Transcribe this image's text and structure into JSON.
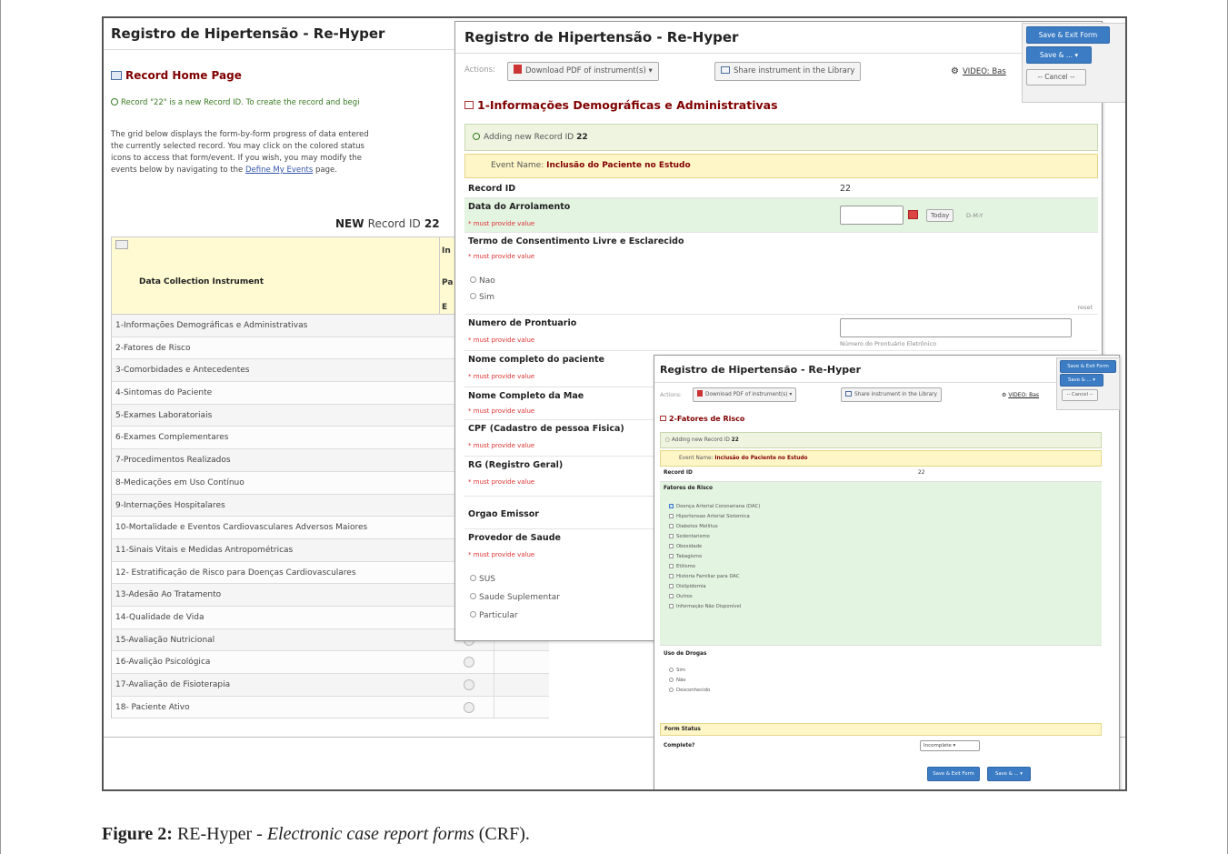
{
  "window1": {
    "title": "Registro de Hipertensão - Re-Hyper",
    "section_title": "Record Home Page",
    "new_record_msg": "Record \"22\" is a new Record ID. To create the record and begi",
    "description_a": "The grid below displays the form-by-form progress of data entered",
    "description_b": "the currently selected record. You may click on the colored status",
    "description_c": "icons to access that form/event. If you wish, you may modify the",
    "description_d_pre": "events below by navigating to the",
    "description_link": "Define My Events",
    "description_d_post": "page.",
    "grid_title_bold": "NEW",
    "grid_title_rest": "Record ID",
    "grid_title_id": "22",
    "col_instrument": "Data Collection Instrument",
    "col_header_parts": [
      "In",
      "Pa",
      "E"
    ],
    "instruments": [
      "1-Informações Demográficas e Administrativas",
      "2-Fatores de Risco",
      "3-Comorbidades e Antecedentes",
      "4-Sintomas do Paciente",
      "5-Exames Laboratoriais",
      "6-Exames Complementares",
      "7-Procedimentos Realizados",
      "8-Medicações em Uso Contínuo",
      "9-Internações Hospitalares",
      "10-Mortalidade e Eventos Cardiovasculares Adversos Maiores",
      "11-Sinais Vitais e Medidas Antropométricas",
      "12- Estratificação de Risco para Doenças Cardiovasculares",
      "13-Adesão Ao Tratamento",
      "14-Qualidade de Vida",
      "15-Avaliação Nutricional",
      "16-Avalição Psicológica",
      "17-Avaliação de Fisioterapia",
      "18- Paciente Ativo"
    ]
  },
  "window2": {
    "title": "Registro de Hipertensão - Re-Hyper",
    "actions_label": "Actions:",
    "download_pdf": "Download PDF of instrument(s)",
    "share_library": "Share instrument in the Library",
    "video": "VIDEO: Bas",
    "form_title": "1-Informações Demográficas e Administrativas",
    "adding_record": "Adding new Record ID",
    "record_id_value": "22",
    "event_label": "Event Name:",
    "event_name": "Inclusão do Paciente no Estudo",
    "must_provide": "* must provide value",
    "fields": {
      "record_id": "Record ID",
      "data_arrolamento": "Data do Arrolamento",
      "termo": "Termo de Consentimento Livre e Esclarecido",
      "nao": "Nao",
      "sim": "Sim",
      "prontuario": "Numero de Prontuario",
      "prontuario_hint": "Número do Prontuário Eletrônico",
      "nome": "Nome completo do paciente",
      "nome_mae": "Nome Completo da Mae",
      "cpf": "CPF (Cadastro de pessoa Fisica)",
      "rg": "RG (Registro Geral)",
      "orgao": "Orgao Emissor",
      "provedor": "Provedor de Saude",
      "sus": "SUS",
      "suplementar": "Saude Suplementar",
      "particular": "Particular"
    },
    "today": "Today",
    "date_format": "D-M-Y",
    "reset": "reset"
  },
  "top_buttons": {
    "save_exit": "Save & Exit Form",
    "save_and": "Save & ...",
    "cancel": "-- Cancel --"
  },
  "window3": {
    "title": "Registro de Hipertensão - Re-Hyper",
    "actions_label": "Actions:",
    "download_pdf": "Download PDF of instrument(s)",
    "share_library": "Share instrument in the Library",
    "video": "VIDEO: Bas",
    "form_title": "2-Fatores de Risco",
    "adding_record": "Adding new Record ID",
    "record_id_value": "22",
    "event_label": "Event Name:",
    "event_name": "Inclusão do Paciente no Estudo",
    "record_id_label": "Record ID",
    "risk_label": "Fatores de Risco",
    "risk_factors": [
      "Doença Arterial Coronariana (DAC)",
      "Hipertensao Arterial Sistemica",
      "Diabetes Mellitus",
      "Sedentarismo",
      "Obesidade",
      "Tabagismo",
      "Etilismo",
      "Historia Familiar para DAC",
      "Dislipidemia",
      "Outros",
      "Informação Não Disponível"
    ],
    "drugs_label": "Uso de Drogas",
    "drug_options": [
      "Sim",
      "Não",
      "Desconhecido"
    ],
    "form_status": "Form Status",
    "complete_label": "Complete?",
    "complete_value": "Incomplete",
    "save_exit": "Save & Exit Form",
    "save_and": "Save & ...",
    "cancel": "-- Cancel --"
  },
  "caption": {
    "label": "Figure 2:",
    "text_pre": "RE-Hyper -",
    "text_italic": "Electronic case report forms",
    "text_post": "(CRF)."
  }
}
